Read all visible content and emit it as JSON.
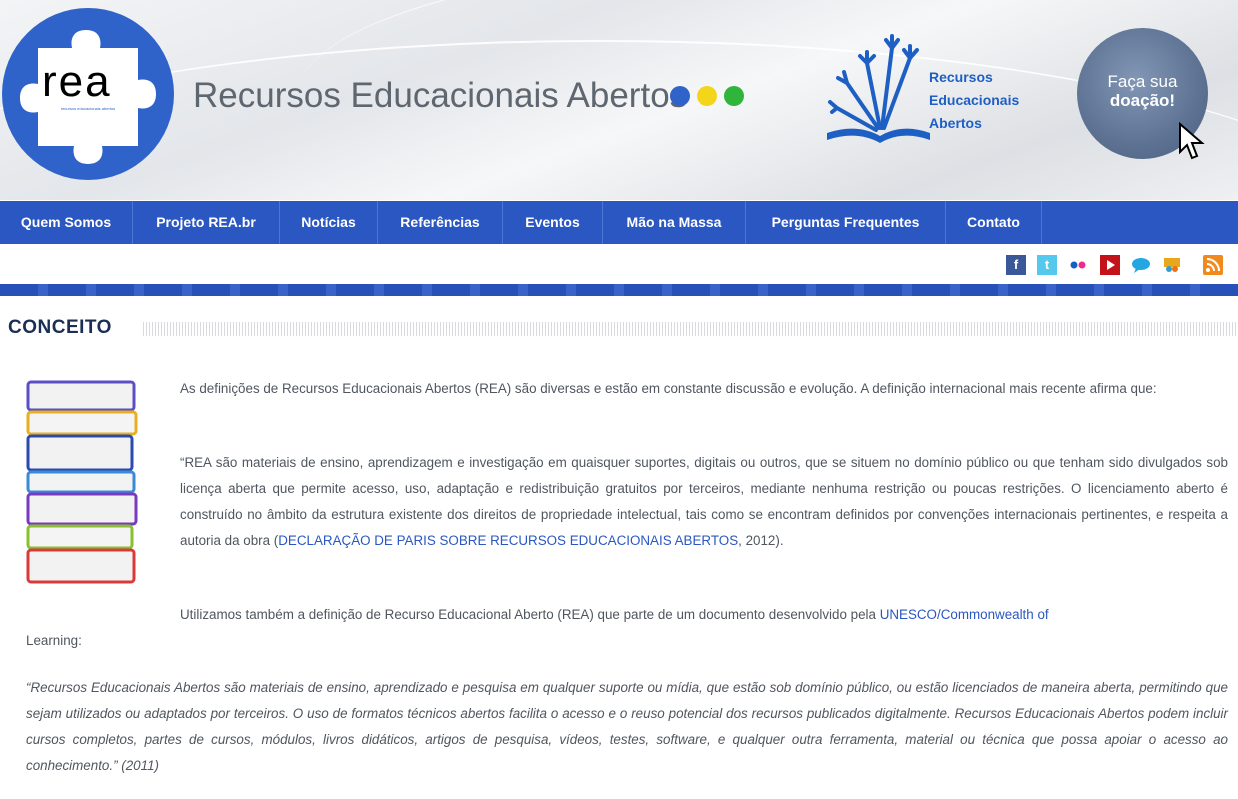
{
  "header": {
    "logo_text": "rea",
    "logo_subtext": "recursos educacionais abertos",
    "site_title": "Recursos Educacionais Abertos",
    "side_logo_lines": [
      "Recursos",
      "Educacionais",
      "Abertos"
    ],
    "donate_line1": "Faça sua",
    "donate_line2": "doação!"
  },
  "colors": {
    "nav_blue": "#2a57c2",
    "dot_blue": "#2f63c9",
    "dot_yellow": "#f3d51a",
    "dot_green": "#2fb53c",
    "heading": "#1b2f52",
    "link": "#2a57c2"
  },
  "nav": {
    "items": [
      {
        "label": "Quem Somos"
      },
      {
        "label": "Projeto REA.br"
      },
      {
        "label": "Notícias"
      },
      {
        "label": "Referências"
      },
      {
        "label": "Eventos"
      },
      {
        "label": "Mão na Massa"
      },
      {
        "label": "Perguntas Frequentes"
      },
      {
        "label": "Contato"
      }
    ]
  },
  "social": {
    "icons": [
      "facebook-icon",
      "twitter-icon",
      "flickr-icon",
      "youtube-icon",
      "chat-icon",
      "slideshare-icon",
      "rss-icon"
    ]
  },
  "content": {
    "heading": "CONCEITO",
    "p1": "As definições de Recursos Educacionais Abertos (REA) são diversas e estão em constante discussão e evolução. A definição internacional mais recente afirma que:",
    "p2_text": "“REA são materiais de ensino, aprendizagem e investigação em quaisquer suportes, digitais ou outros, que se situem no domínio público ou que tenham sido divulgados sob licença aberta que permite acesso, uso, adaptação e redistribuição gratuitos por terceiros, mediante nenhuma restrição ou poucas restrições. O licenciamento aberto é construído no âmbito da estrutura existente dos direitos de propriedade intelectual, tais como se encontram definidos por convenções internacionais pertinentes, e respeita a autoria da obra (",
    "p2_link": "DECLARAÇÃO DE PARIS SOBRE RECURSOS EDUCACIONAIS ABERTOS",
    "p2_end": ", 2012).",
    "p3_text": "Utilizamos também a definição de Recurso Educacional Aberto (REA) que parte de um documento desenvolvido pela ",
    "p3_link": "UNESCO/Commonwealth of",
    "p3_end": "Learning:",
    "quote": "“Recursos Educacionais Abertos são materiais de ensino, aprendizado e pesquisa em qualquer suporte ou mídia, que estão sob domínio público, ou estão licenciados de maneira aberta, permitindo que sejam utilizados ou adaptados por terceiros. O uso de formatos técnicos abertos facilita o acesso e o reuso potencial dos recursos publicados digitalmente. Recursos Educacionais Abertos podem incluir cursos completos, partes de cursos, módulos, livros didáticos, artigos de pesquisa, vídeos, testes, software, e qualquer outra ferramenta, material ou técnica que possa apoiar o acesso ao conhecimento.” (2011)"
  }
}
